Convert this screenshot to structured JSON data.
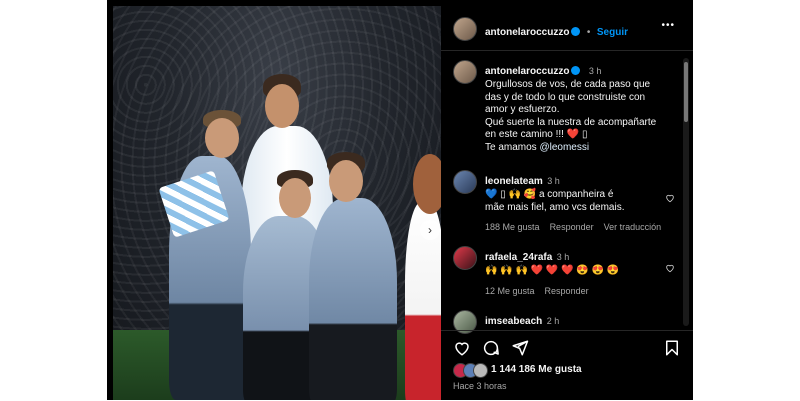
{
  "post": {
    "username": "antonelaroccuzzo",
    "separator": "•",
    "follow_label": "Seguir",
    "more_label": "•••"
  },
  "caption": {
    "username": "antonelaroccuzzo",
    "time": "3 h",
    "lines": [
      "Orgullosos de vos, de cada paso que",
      "das y de todo lo que construiste  con",
      "amor y esfuerzo.",
      "Qué suerte la nuestra de acompañarte",
      "en este camino !!! ❤️ ▯",
      "Te amamos"
    ],
    "mention": "@leomessi"
  },
  "comments": [
    {
      "username": "leonelateam",
      "time": "3 h",
      "lines": [
        "💙 ▯ 🙌 🥰  a companheira é",
        "mãe mais fiel, amo vcs demais."
      ],
      "likes": "188 Me gusta",
      "reply": "Responder",
      "translate": "Ver traducción"
    },
    {
      "username": "rafaela_24rafa",
      "time": "3 h",
      "lines": [
        "🙌 🙌 🙌 ❤️ ❤️ ❤️ 😍 😍 😍"
      ],
      "likes": "12 Me gusta",
      "reply": "Responder"
    },
    {
      "username": "imseabeach",
      "time": "2 h"
    }
  ],
  "footer": {
    "likes": "1 144 186 Me gusta",
    "time_ago": "Hace 3 horas"
  },
  "icons": {
    "like": "heart-icon",
    "comment": "comment-icon",
    "share": "share-icon",
    "save": "bookmark-icon",
    "next": "chevron-right-icon"
  },
  "colors": {
    "background": "#000000",
    "verified": "#0095f6",
    "follow": "#0095f6",
    "meta": "#a8a8a8"
  }
}
